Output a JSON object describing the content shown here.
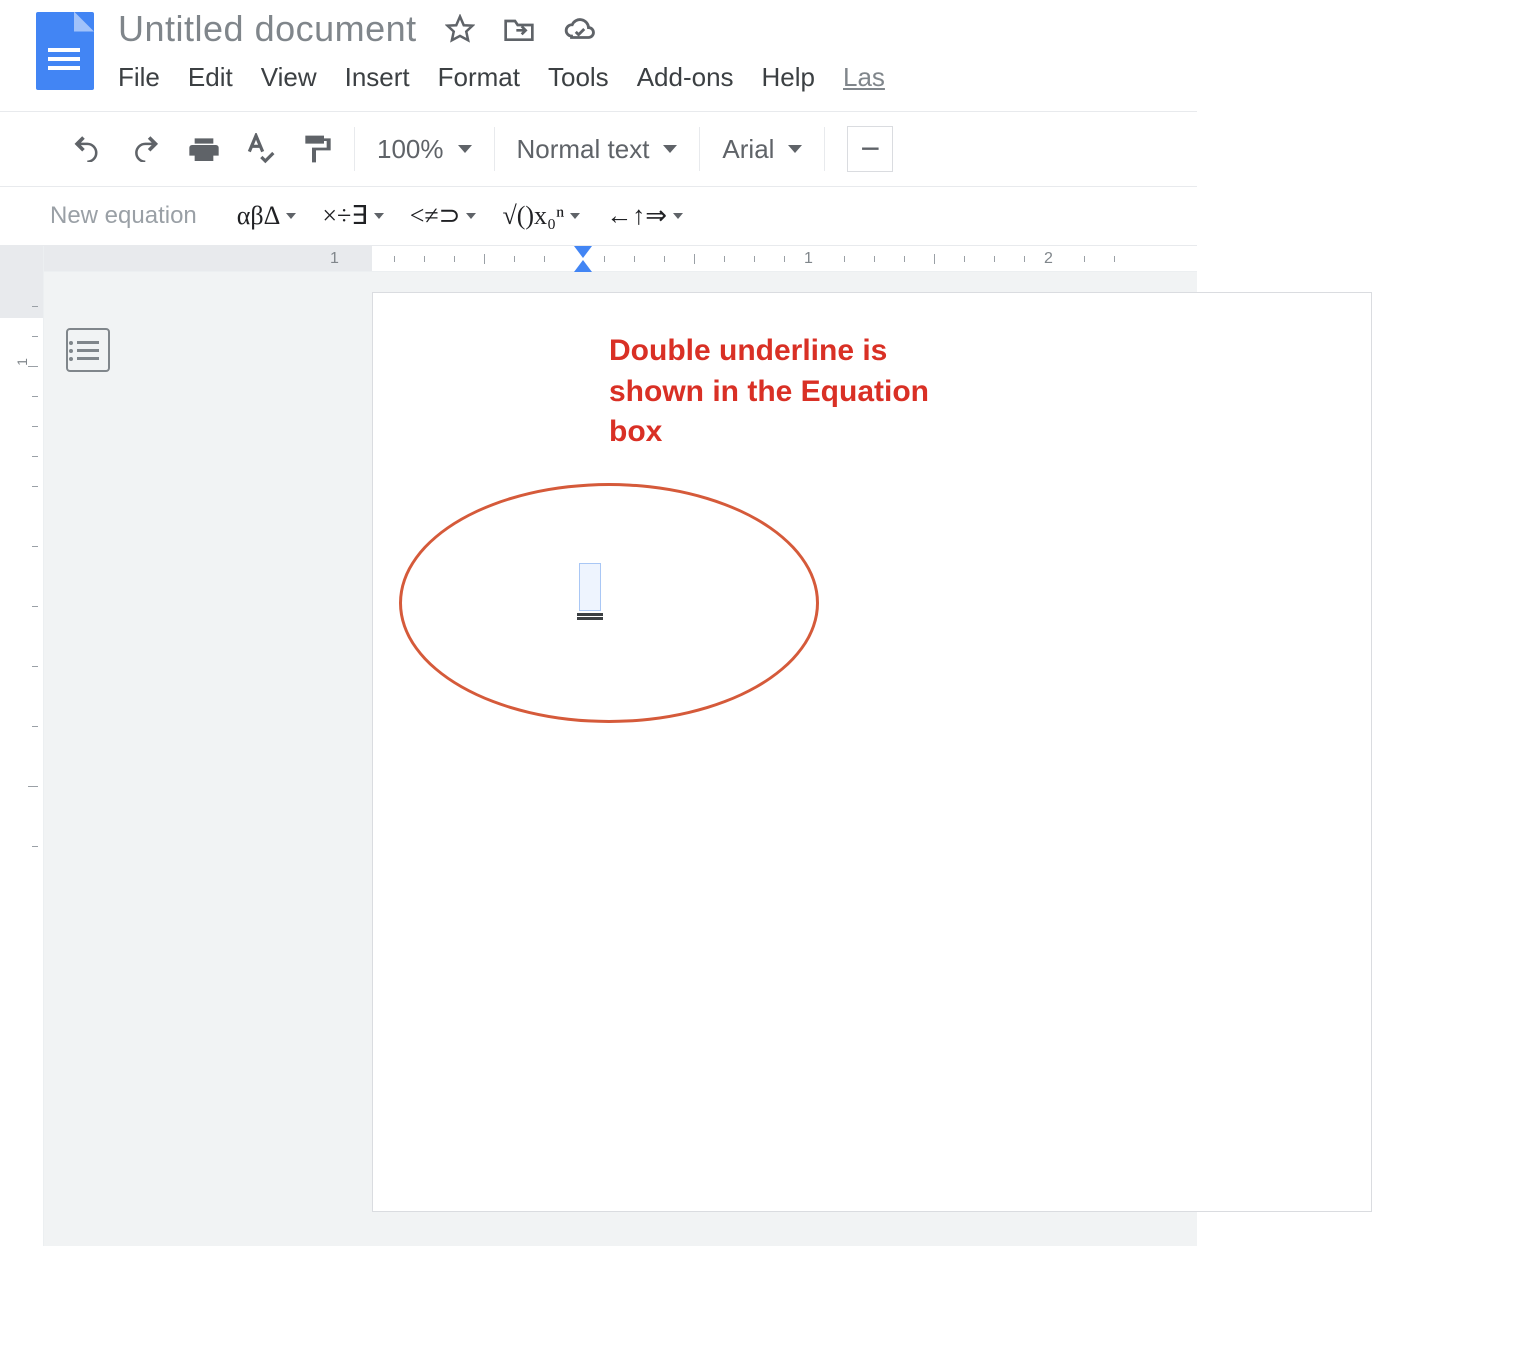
{
  "header": {
    "title": "Untitled document",
    "last_edit": "Las"
  },
  "menu": {
    "items": [
      "File",
      "Edit",
      "View",
      "Insert",
      "Format",
      "Tools",
      "Add-ons",
      "Help"
    ]
  },
  "toolbar": {
    "zoom": "100%",
    "style": "Normal text",
    "font": "Arial",
    "minus": "−"
  },
  "equation_toolbar": {
    "new_label": "New equation",
    "groups": [
      "αβΔ",
      "×÷∃",
      "<≠⊃",
      "√()x₀ⁿ",
      "←↑⇒"
    ]
  },
  "ruler": {
    "h_numbers": [
      "1",
      "1",
      "2"
    ],
    "v_number": "1"
  },
  "document": {
    "annotation": "Double underline is shown in the Equation box"
  }
}
